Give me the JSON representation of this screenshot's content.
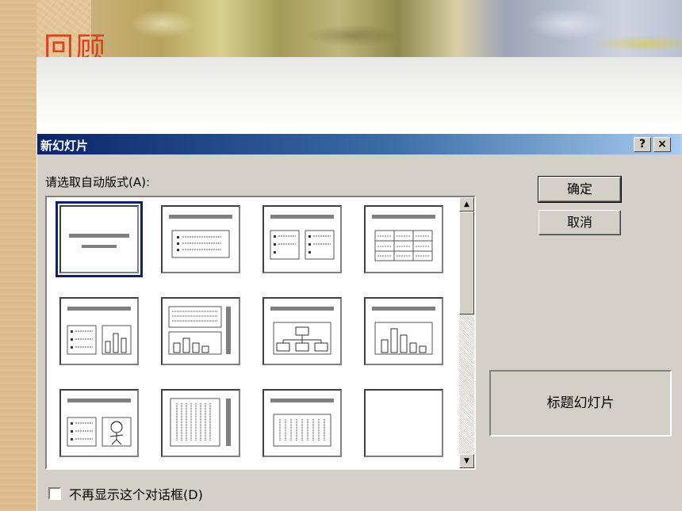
{
  "slide": {
    "title": "回顾"
  },
  "dialog": {
    "title": "新幻灯片",
    "help_label": "?",
    "close_label": "×",
    "prompt": "请选取自动版式(A):",
    "ok_label": "确定",
    "cancel_label": "取消",
    "selected_layout_name": "标题幻灯片",
    "checkbox_label": "不再显示这个对话框(D)",
    "checkbox_checked": false,
    "scroll_up": "▲",
    "scroll_down": "▼"
  },
  "layouts": [
    {
      "icon": "title-slide-layout-icon",
      "selected": true
    },
    {
      "icon": "bulleted-list-layout-icon",
      "selected": false
    },
    {
      "icon": "two-column-text-layout-icon",
      "selected": false
    },
    {
      "icon": "table-layout-icon",
      "selected": false
    },
    {
      "icon": "text-and-chart-layout-icon",
      "selected": false
    },
    {
      "icon": "chart-and-text-layout-icon",
      "selected": false
    },
    {
      "icon": "organization-chart-layout-icon",
      "selected": false
    },
    {
      "icon": "chart-layout-icon",
      "selected": false
    },
    {
      "icon": "text-and-clip-art-layout-icon",
      "selected": false
    },
    {
      "icon": "vertical-title-and-text-layout-icon",
      "selected": false
    },
    {
      "icon": "vertical-text-layout-icon",
      "selected": false
    },
    {
      "icon": "blank-layout-icon",
      "selected": false
    }
  ],
  "colors": {
    "title_red": "#e0401e",
    "titlebar_dark": "#0a246a",
    "titlebar_light": "#a6caf0",
    "dialog_face": "#d4d0c8"
  }
}
